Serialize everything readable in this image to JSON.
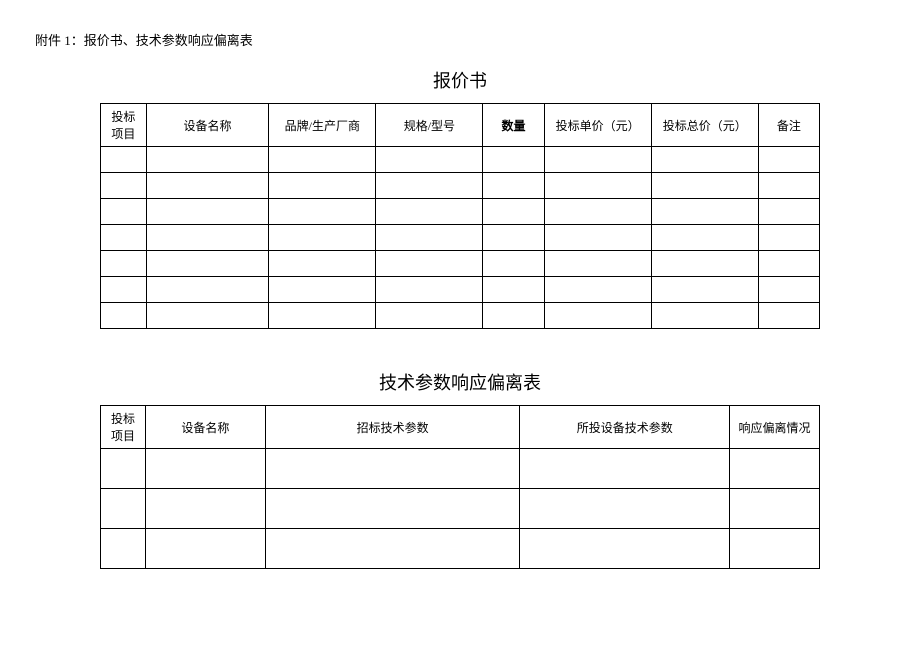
{
  "attachment_label": "附件 1：报价书、技术参数响应偏离表",
  "table1": {
    "title": "报价书",
    "headers": {
      "col1_line1": "投标",
      "col1_line2": "项目",
      "col2": "设备名称",
      "col3": "品牌/生产厂商",
      "col4": "规格/型号",
      "col5": "数量",
      "col6": "投标单价（元）",
      "col7": "投标总价（元）",
      "col8": "备注"
    },
    "rows": [
      {
        "c1": "",
        "c2": "",
        "c3": "",
        "c4": "",
        "c5": "",
        "c6": "",
        "c7": "",
        "c8": ""
      },
      {
        "c1": "",
        "c2": "",
        "c3": "",
        "c4": "",
        "c5": "",
        "c6": "",
        "c7": "",
        "c8": ""
      },
      {
        "c1": "",
        "c2": "",
        "c3": "",
        "c4": "",
        "c5": "",
        "c6": "",
        "c7": "",
        "c8": ""
      },
      {
        "c1": "",
        "c2": "",
        "c3": "",
        "c4": "",
        "c5": "",
        "c6": "",
        "c7": "",
        "c8": ""
      },
      {
        "c1": "",
        "c2": "",
        "c3": "",
        "c4": "",
        "c5": "",
        "c6": "",
        "c7": "",
        "c8": ""
      },
      {
        "c1": "",
        "c2": "",
        "c3": "",
        "c4": "",
        "c5": "",
        "c6": "",
        "c7": "",
        "c8": ""
      },
      {
        "c1": "",
        "c2": "",
        "c3": "",
        "c4": "",
        "c5": "",
        "c6": "",
        "c7": "",
        "c8": ""
      }
    ]
  },
  "table2": {
    "title": "技术参数响应偏离表",
    "headers": {
      "col1_line1": "投标",
      "col1_line2": "项目",
      "col2": "设备名称",
      "col3": "招标技术参数",
      "col4": "所投设备技术参数",
      "col5": "响应偏离情况"
    },
    "rows": [
      {
        "c1": "",
        "c2": "",
        "c3": "",
        "c4": "",
        "c5": ""
      },
      {
        "c1": "",
        "c2": "",
        "c3": "",
        "c4": "",
        "c5": ""
      },
      {
        "c1": "",
        "c2": "",
        "c3": "",
        "c4": "",
        "c5": ""
      }
    ]
  }
}
